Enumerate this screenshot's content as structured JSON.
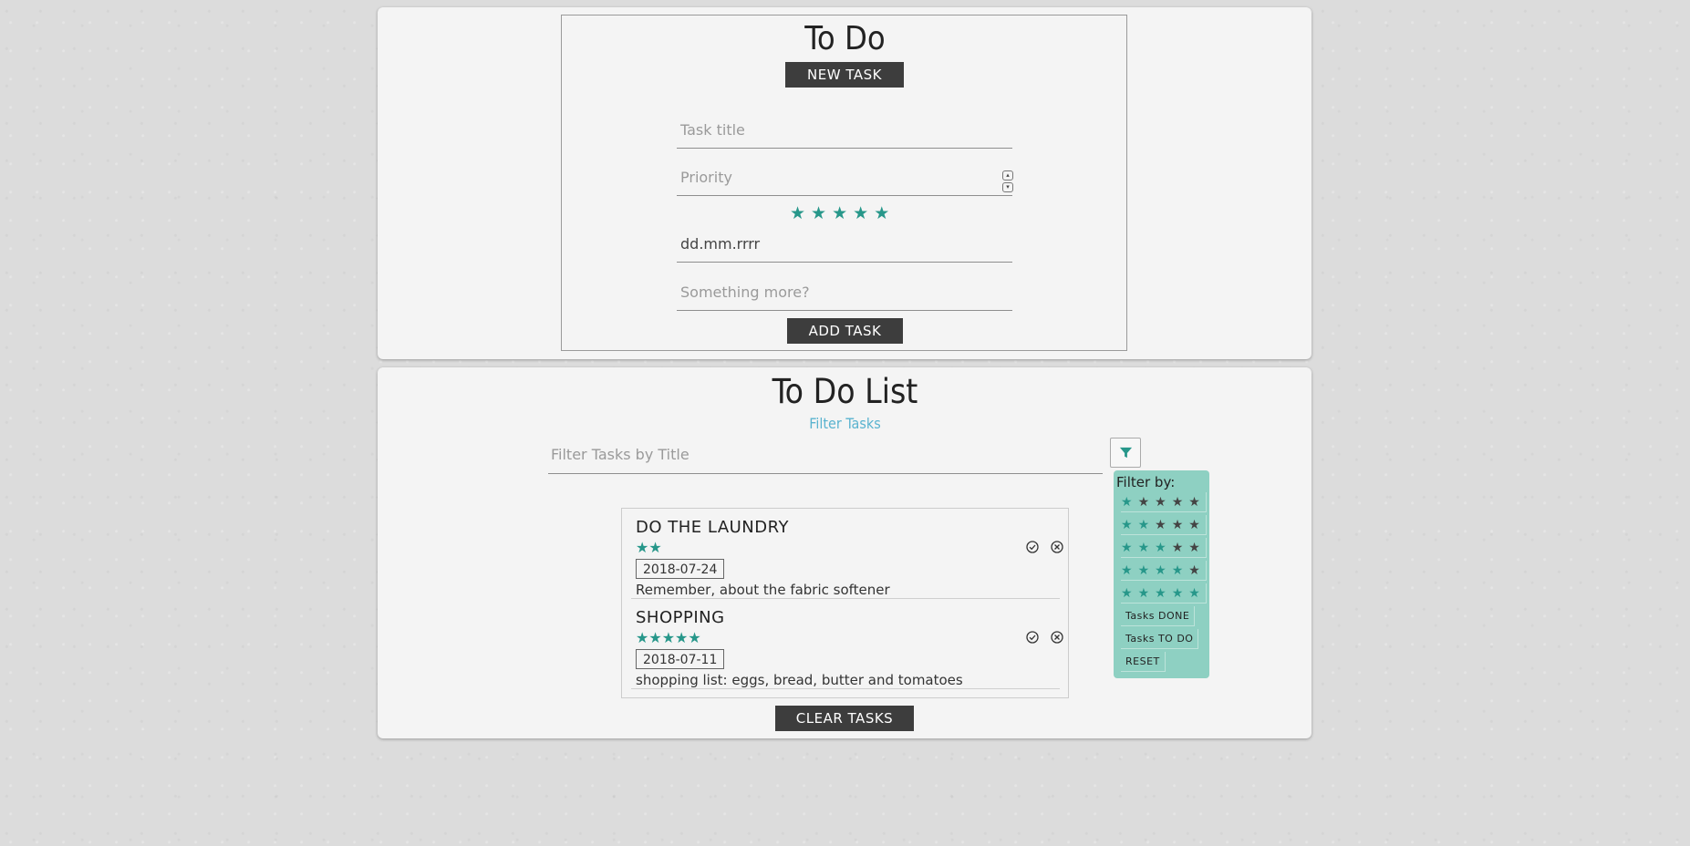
{
  "form": {
    "title": "To Do",
    "new_task_label": "NEW TASK",
    "task_title_placeholder": "Task title",
    "priority_placeholder": "Priority",
    "priority_stars": 5,
    "date_placeholder": "dd.mm.rrrr",
    "notes_placeholder": "Something more?",
    "add_task_label": "ADD TASK"
  },
  "list": {
    "title": "To Do List",
    "filter_link": "Filter Tasks",
    "filter_placeholder": "Filter Tasks by Title",
    "filter_icon": "filter-icon",
    "filter_panel": {
      "header": "Filter by:",
      "star_rows": [
        1,
        2,
        3,
        4,
        5
      ],
      "buttons": [
        "Tasks DONE",
        "Tasks TO DO",
        "RESET"
      ]
    },
    "tasks": [
      {
        "title": "DO THE LAUNDRY",
        "stars": 2,
        "date": "2018-07-24",
        "description": "Remember, about the fabric softener"
      },
      {
        "title": "SHOPPING",
        "stars": 5,
        "date": "2018-07-11",
        "description": "shopping list: eggs, bread, butter and tomatoes"
      }
    ],
    "clear_label": "CLEAR TASKS"
  },
  "colors": {
    "accent": "#27978a",
    "panel": "#8ed0c2",
    "button": "#3d3d3d",
    "link": "#5ab3cf"
  }
}
